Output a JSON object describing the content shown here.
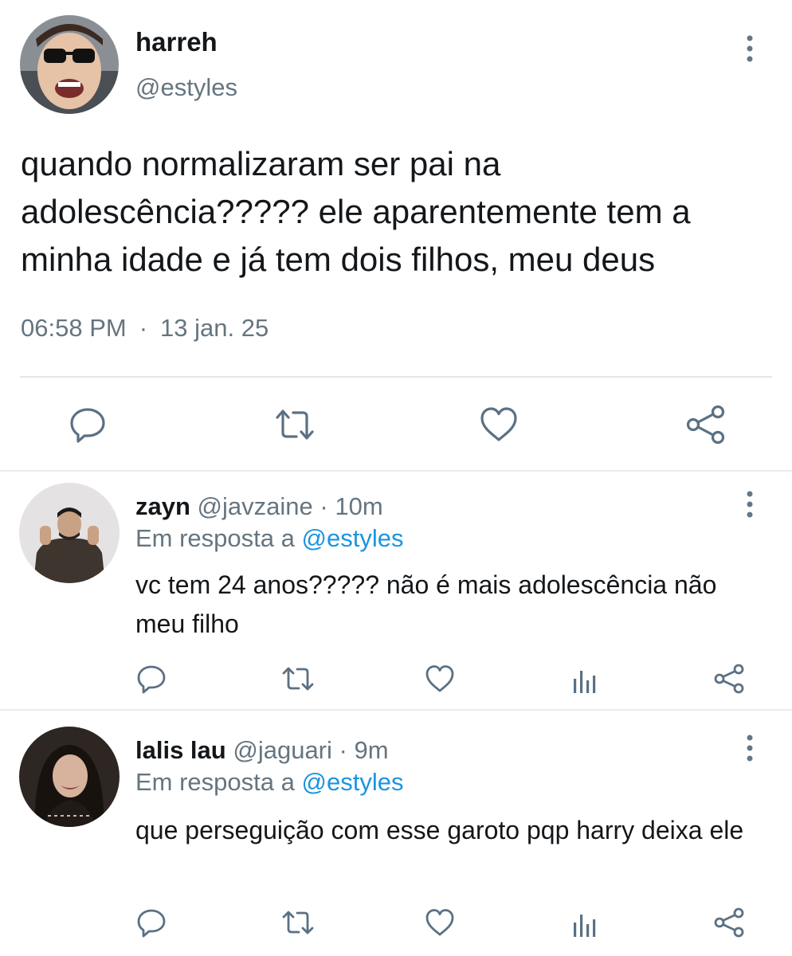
{
  "main_tweet": {
    "name": "harreh",
    "handle": "@estyles",
    "text": "quando normalizaram ser pai na adolescência????? ele aparentemente tem a minha idade e já tem dois filhos, meu deus",
    "time": "06:58 PM",
    "separator": "·",
    "date": "13 jan. 25",
    "icons": [
      "reply-icon",
      "retweet-icon",
      "like-icon",
      "share-icon"
    ]
  },
  "replies": [
    {
      "name": "zayn",
      "handle": "@javzaine",
      "separator": "·",
      "time": "10m",
      "reply_prefix": "Em resposta a",
      "reply_to": "@estyles",
      "text": "vc tem 24 anos????? não é mais adolescência não meu filho"
    },
    {
      "name": "lalis lau",
      "handle": "@jaguari",
      "separator": "·",
      "time": "9m",
      "reply_prefix": "Em resposta a",
      "reply_to": "@estyles",
      "text": "que perseguição com esse garoto pqp harry deixa ele"
    }
  ],
  "colors": {
    "text": "#14171a",
    "secondary": "#66757f",
    "link": "#1b95e0",
    "icon": "#5b7083"
  }
}
